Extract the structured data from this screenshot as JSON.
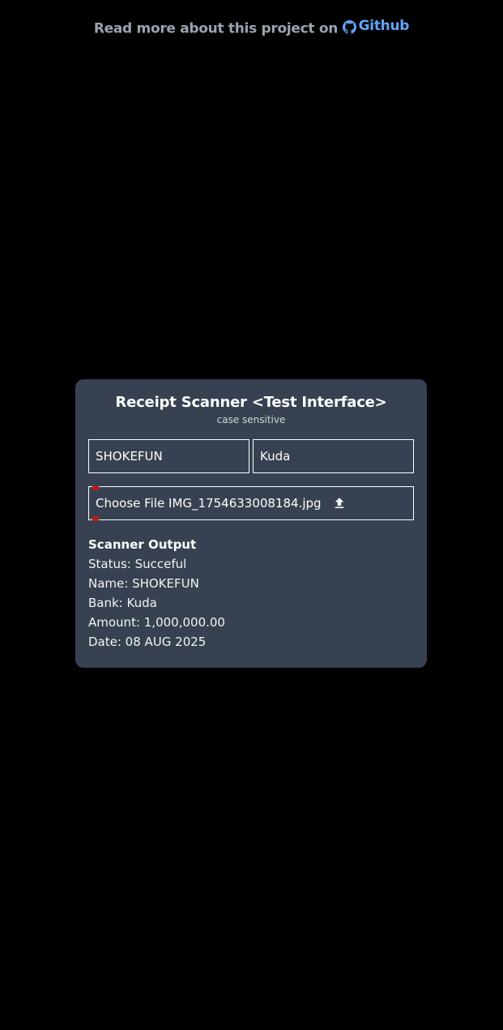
{
  "banner": {
    "text": "Read more about this project on",
    "link_label": "Github",
    "link_icon": "github-icon"
  },
  "card": {
    "title": "Receipt Scanner <Test Interface>",
    "subtitle": "case sensitive",
    "name_input_value": "SHOKEFUN",
    "bank_input_value": "Kuda",
    "file": {
      "choose_label": "Choose File",
      "file_name": "IMG_1754633008184.jpg",
      "upload_icon": "upload-icon"
    },
    "output": {
      "heading": "Scanner Output",
      "status": "Status: Succeful",
      "name": "Name: SHOKEFUN",
      "bank": "Bank: Kuda",
      "amount": "Amount: 1,000,000.00",
      "date": "Date: 08 AUG 2025"
    }
  },
  "colors": {
    "background": "#000000",
    "card": "#374151",
    "link": "#60a5fa",
    "muted": "#9ca3af"
  }
}
